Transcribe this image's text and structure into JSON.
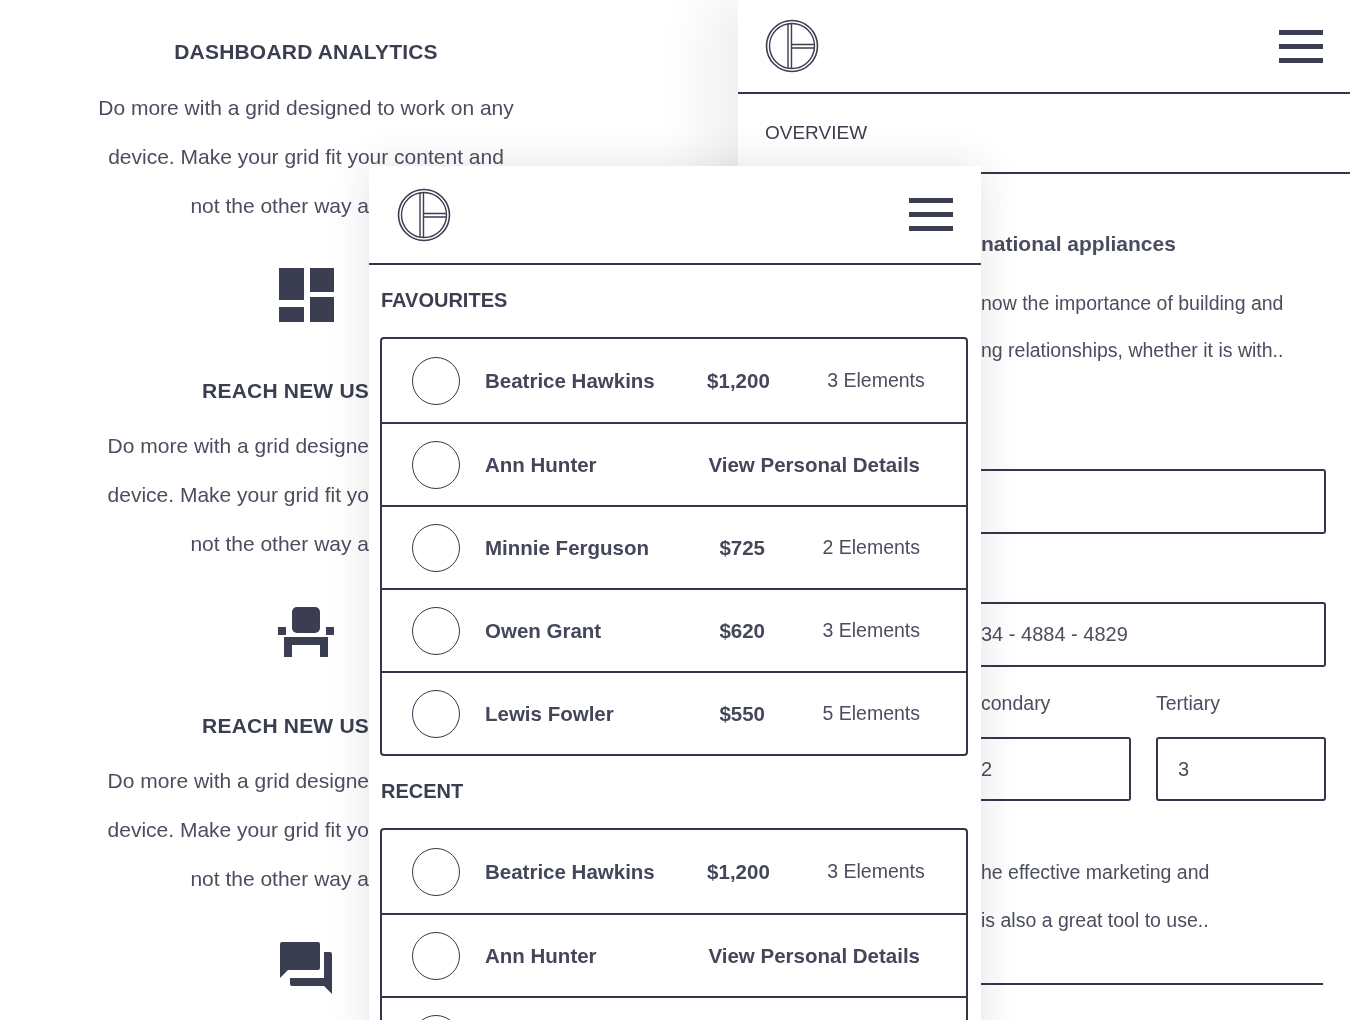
{
  "left_screen": {
    "heading": "DASHBOARD ANALYTICS",
    "intro": [
      "Do more with a grid designed to work on any",
      "device. Make your grid fit your content and"
    ],
    "blocks": [
      {
        "lines": [
          "not the other way a"
        ]
      },
      {
        "title": "REACH NEW US",
        "lines": [
          "Do more with a grid designe",
          "device. Make your grid fit yo",
          "not the other way a"
        ]
      },
      {
        "title": "REACH NEW US",
        "lines": [
          "Do more with a grid designe",
          "device. Make your grid fit yo",
          "not the other way a"
        ]
      }
    ]
  },
  "right_screen": {
    "tab": "OVERVIEW",
    "heading": "national appliances",
    "paragraph": [
      "now the importance of building and",
      "ng relationships, whether it is with.."
    ],
    "fields": [
      {
        "kind": "blank"
      },
      {
        "kind": "filled",
        "value": "34 - 4884 - 4829"
      }
    ],
    "split_fields": [
      {
        "label": "condary",
        "value": "2"
      },
      {
        "label": "Tertiary",
        "value": "3"
      }
    ],
    "closing": [
      "he effective marketing and",
      "is also a great tool to use.."
    ]
  },
  "middle_screen": {
    "sections": [
      {
        "title": "FAVOURITES",
        "rows": [
          {
            "kind": "summary",
            "name": "Beatrice Hawkins",
            "amount": "$1,200",
            "count": "3 Elements",
            "selected": false
          },
          {
            "kind": "details",
            "name": "Ann Hunter",
            "link": "View Personal Details",
            "selected": false
          },
          {
            "kind": "summary",
            "name": "Minnie Ferguson",
            "amount": "$725",
            "count": "2 Elements",
            "selected": false
          },
          {
            "kind": "summary",
            "name": "Owen Grant",
            "amount": "$620",
            "count": "3 Elements",
            "selected": false
          },
          {
            "kind": "summary",
            "name": "Lewis Fowler",
            "amount": "$550",
            "count": "5 Elements",
            "selected": false
          }
        ]
      },
      {
        "title": "RECENT",
        "rows": [
          {
            "kind": "summary",
            "name": "Beatrice Hawkins",
            "amount": "$1,200",
            "count": "3 Elements",
            "selected": false
          },
          {
            "kind": "details",
            "name": "Ann Hunter",
            "link": "View Personal Details",
            "selected": false
          },
          {
            "kind": "cut"
          }
        ]
      }
    ]
  }
}
